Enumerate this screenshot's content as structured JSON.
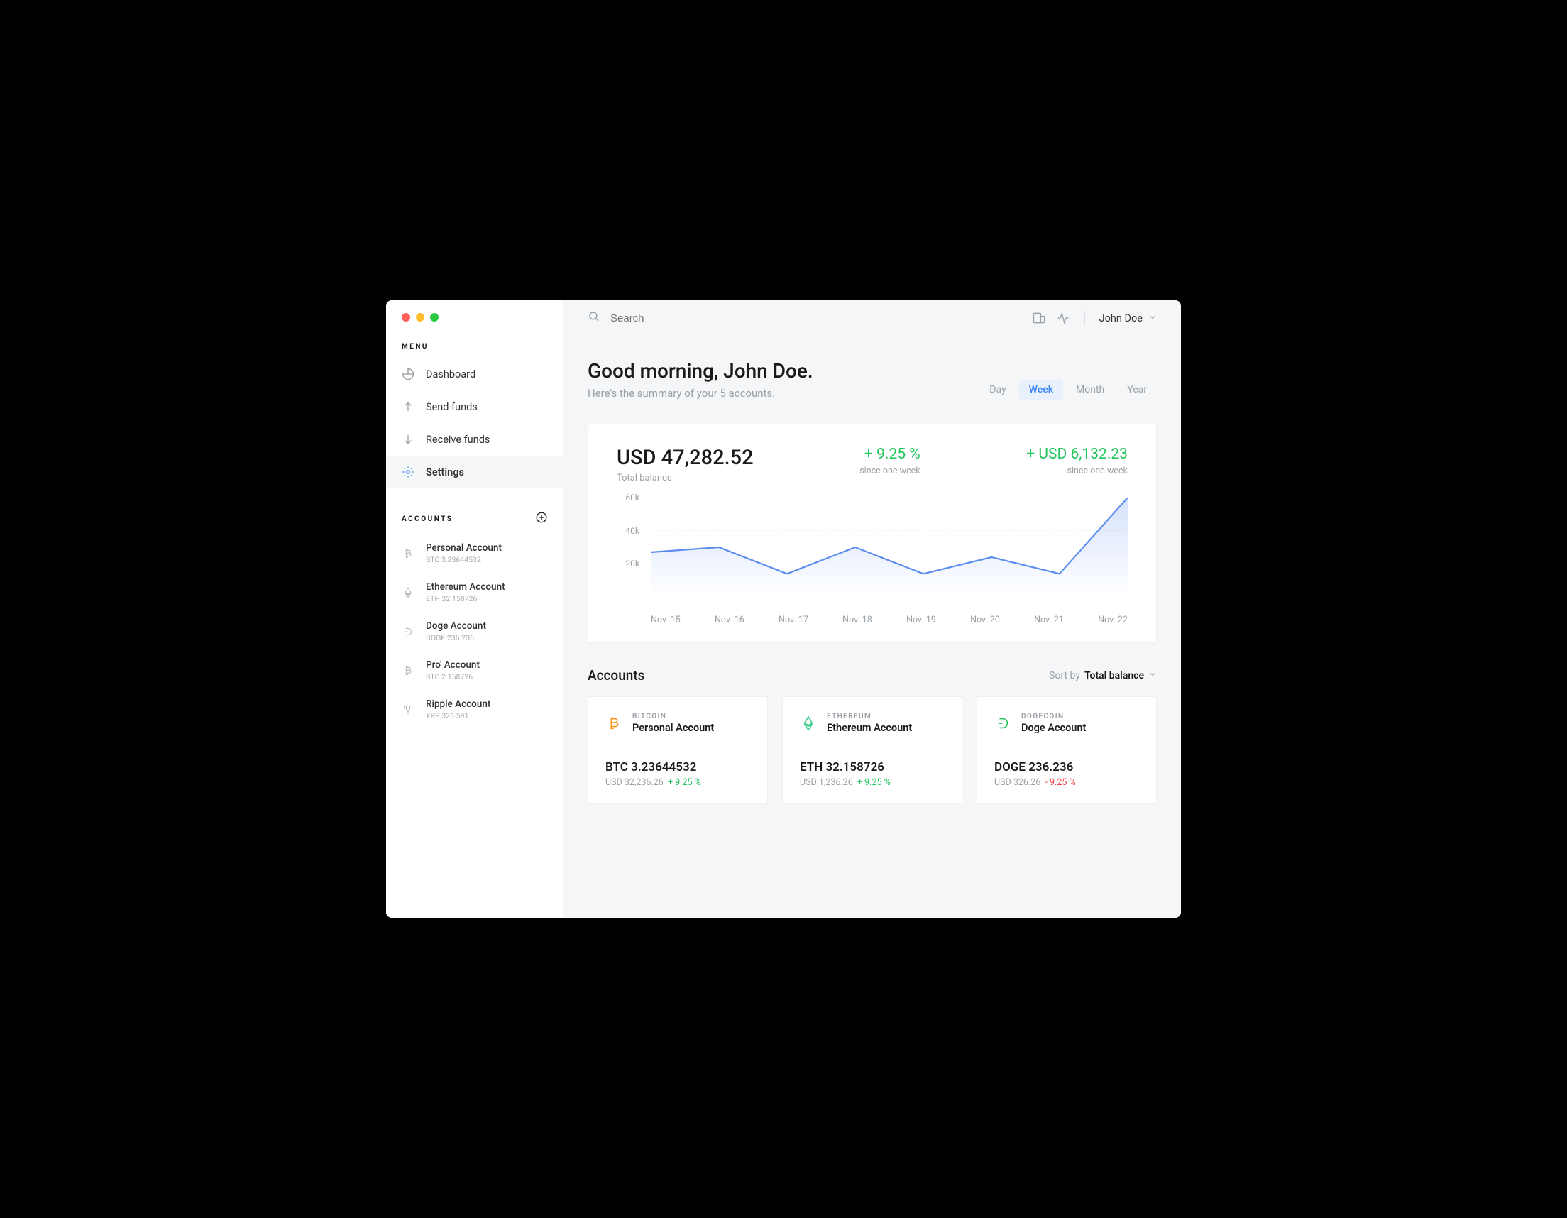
{
  "sidebar": {
    "menu_label": "MENU",
    "items": [
      {
        "label": "Dashboard"
      },
      {
        "label": "Send funds"
      },
      {
        "label": "Receive funds"
      },
      {
        "label": "Settings"
      }
    ],
    "accounts_label": "ACCOUNTS",
    "accounts": [
      {
        "name": "Personal Account",
        "sub": "BTC 3.23644532"
      },
      {
        "name": "Ethereum Account",
        "sub": "ETH 32.158726"
      },
      {
        "name": "Doge Account",
        "sub": "DOGE 236.236"
      },
      {
        "name": "Pro' Account",
        "sub": "BTC 2.158726"
      },
      {
        "name": "Ripple Account",
        "sub": "XRP 326.591"
      }
    ]
  },
  "topbar": {
    "search_placeholder": "Search",
    "user_name": "John Doe"
  },
  "hero": {
    "greeting": "Good morning, John Doe.",
    "subtitle": "Here's the summary of your 5 accounts.",
    "ranges": [
      "Day",
      "Week",
      "Month",
      "Year"
    ],
    "active_range": "Week"
  },
  "balance": {
    "amount": "USD 47,282.52",
    "label": "Total balance",
    "pct": "+ 9.25 %",
    "pct_sub": "since one week",
    "delta": "+ USD 6,132.23",
    "delta_sub": "since one week"
  },
  "chart_data": {
    "type": "line",
    "categories": [
      "Nov. 15",
      "Nov. 16",
      "Nov. 17",
      "Nov. 18",
      "Nov. 19",
      "Nov. 20",
      "Nov. 21",
      "Nov. 22"
    ],
    "values": [
      27000,
      30000,
      14000,
      30000,
      14000,
      24000,
      14000,
      60000
    ],
    "title": "",
    "xlabel": "",
    "ylabel": "",
    "ylim": [
      0,
      60000
    ],
    "yticks": [
      "60k",
      "40k",
      "20k"
    ]
  },
  "accounts_section": {
    "title": "Accounts",
    "sort_label": "Sort by",
    "sort_value": "Total balance",
    "cards": [
      {
        "coin": "BITCOIN",
        "name": "Personal Account",
        "balance": "BTC 3.23644532",
        "usd": "USD 32,236.26",
        "change": "+ 9.25 %",
        "change_dir": "pos",
        "color": "#f7931a"
      },
      {
        "coin": "ETHEREUM",
        "name": "Ethereum Account",
        "balance": "ETH 32.158726",
        "usd": "USD 1,236.26",
        "change": "+ 9.25 %",
        "change_dir": "pos",
        "color": "#3ecf8e"
      },
      {
        "coin": "DOGECOIN",
        "name": "Doge Account",
        "balance": "DOGE 236.236",
        "usd": "USD 326.26",
        "change": "- 9.25 %",
        "change_dir": "neg",
        "color": "#22c55e"
      }
    ]
  }
}
